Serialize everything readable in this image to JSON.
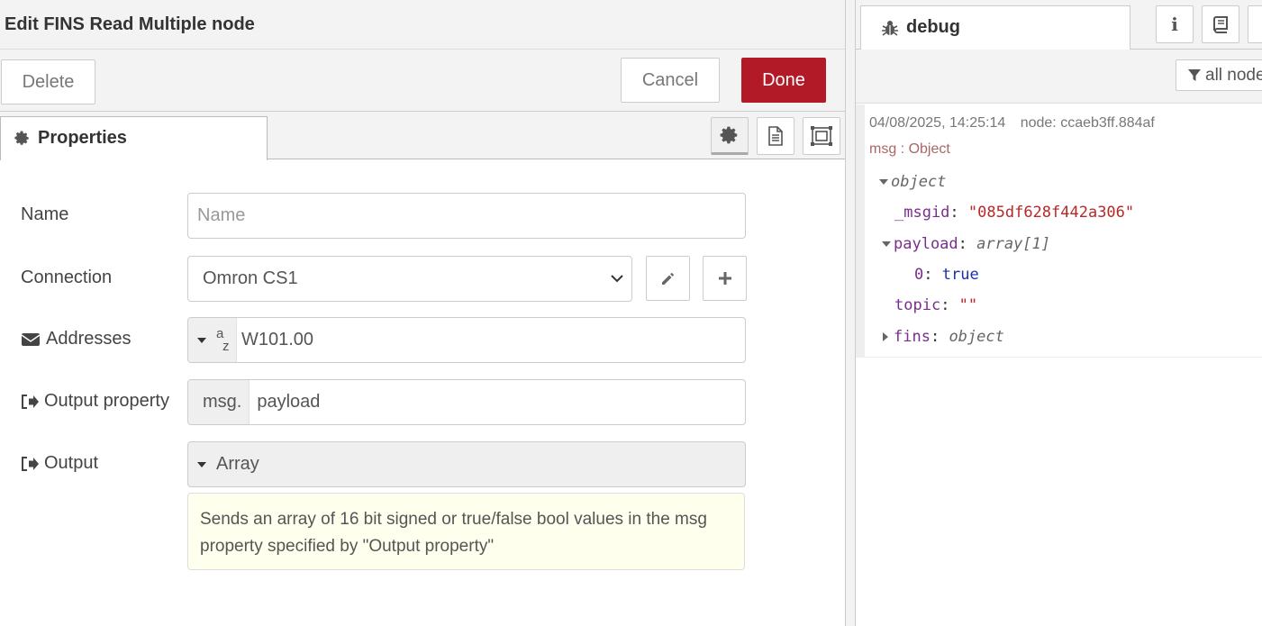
{
  "editor": {
    "title": "Edit FINS Read Multiple node",
    "delete_label": "Delete",
    "cancel_label": "Cancel",
    "done_label": "Done",
    "done_color": "#b31a27",
    "properties_tab": "Properties",
    "fields": {
      "name_label": "Name",
      "name_placeholder": "Name",
      "connection_label": "Connection",
      "connection_value": "Omron CS1",
      "addresses_label": "Addresses",
      "addresses_type": "az",
      "addresses_value": "W101.00",
      "output_property_label": "Output property",
      "output_property_prefix": "msg.",
      "output_property_value": "payload",
      "output_label": "Output",
      "output_value": "Array"
    },
    "help_text": "Sends an array of 16 bit signed or true/false bool values in the msg property specified by \"Output property\""
  },
  "sidebar": {
    "tab_label": "debug",
    "filter_label": "all nodes",
    "message": {
      "timestamp": "04/08/2025, 14:25:14",
      "node": "node: ccaeb3ff.884af",
      "topic": "msg : Object",
      "root_type": "object",
      "msgid_key": "_msgid",
      "msgid_value": "\"085df628f442a306\"",
      "payload_key": "payload",
      "payload_type": "array[1]",
      "item_key": "0",
      "item_value": "true",
      "topic_key": "topic",
      "topic_value": "\"\"",
      "fins_key": "fins",
      "fins_type": "object"
    }
  }
}
